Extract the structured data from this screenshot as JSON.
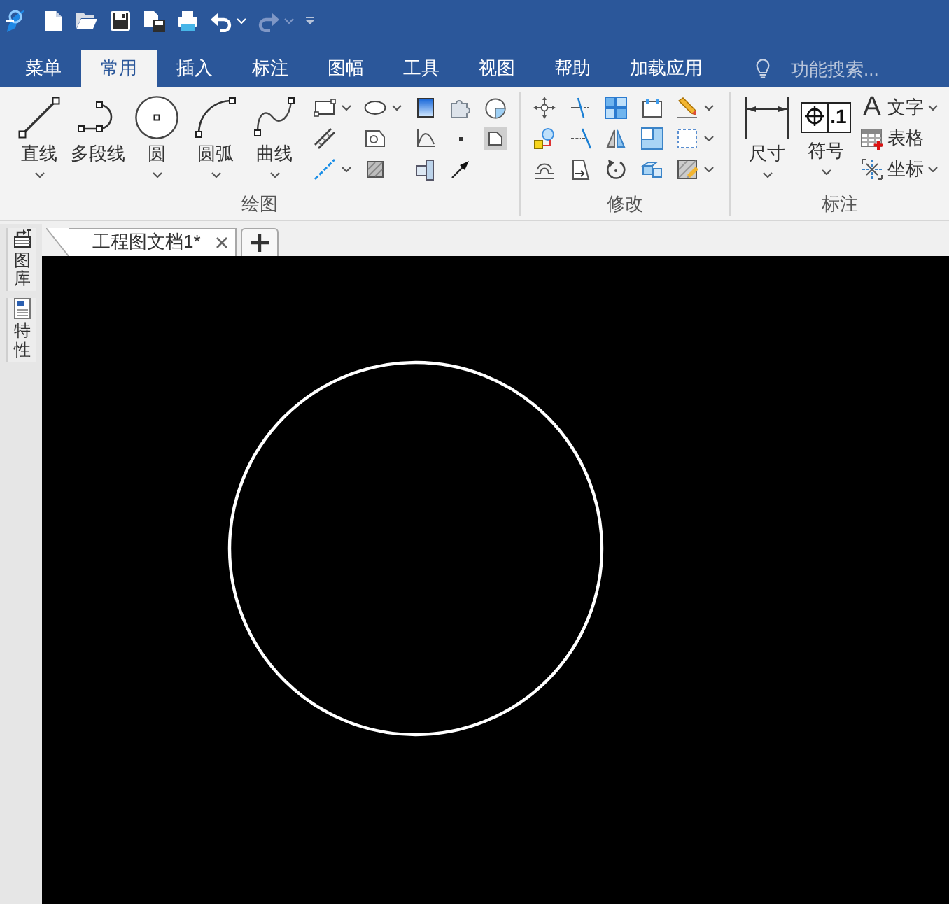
{
  "quick_access": [
    {
      "disabled": false
    },
    {
      "disabled": false
    },
    {
      "disabled": false
    },
    {
      "disabled": false
    },
    {
      "disabled": false
    },
    {
      "disabled": false
    },
    {
      "disabled": true
    }
  ],
  "menu_tabs": [
    {
      "label": "菜单",
      "selected": false
    },
    {
      "label": "常用",
      "selected": true
    },
    {
      "label": "插入",
      "selected": false
    },
    {
      "label": "标注",
      "selected": false
    },
    {
      "label": "图幅",
      "selected": false
    },
    {
      "label": "工具",
      "selected": false
    },
    {
      "label": "视图",
      "selected": false
    },
    {
      "label": "帮助",
      "selected": false
    },
    {
      "label": "加载应用",
      "selected": false
    }
  ],
  "search": {
    "placeholder": "功能搜索..."
  },
  "ribbon": {
    "groups": [
      {
        "label": "绘图",
        "large_tools": [
          {
            "label": "直线",
            "dropdown": true
          },
          {
            "label": "多段线",
            "dropdown": false
          },
          {
            "label": "圆",
            "dropdown": true
          },
          {
            "label": "圆弧",
            "dropdown": true
          },
          {
            "label": "曲线",
            "dropdown": true
          }
        ],
        "small_tools": [
          {
            "dropdown": true
          },
          {
            "dropdown": true
          },
          {
            "dropdown": false
          },
          {
            "dropdown": false
          },
          {
            "dropdown": false
          },
          {
            "dropdown": false
          },
          {
            "dropdown": false
          },
          {
            "dropdown": false
          },
          {
            "dropdown": false
          },
          {
            "dropdown": false
          },
          {
            "dropdown": true
          },
          {
            "dropdown": false
          },
          {
            "dropdown": false
          },
          {
            "dropdown": false
          }
        ]
      },
      {
        "label": "修改",
        "small_tools": [
          {
            "dropdown": false
          },
          {
            "dropdown": false
          },
          {
            "dropdown": false
          },
          {
            "dropdown": false
          },
          {
            "dropdown": true
          },
          {
            "dropdown": false
          },
          {
            "dropdown": false
          },
          {
            "dropdown": false
          },
          {
            "dropdown": false
          },
          {
            "dropdown": true
          },
          {
            "dropdown": false
          },
          {
            "dropdown": false
          },
          {
            "dropdown": false
          },
          {
            "dropdown": false
          },
          {
            "dropdown": true
          }
        ]
      },
      {
        "label": "标注",
        "large_tools": [
          {
            "label": "尺寸",
            "dropdown": true
          },
          {
            "label": "符号",
            "icon_text": ".1",
            "dropdown": true
          }
        ],
        "labeled_tools": [
          {
            "label": "文字",
            "icon_text": "A",
            "dropdown": true
          },
          {
            "label": "表格",
            "dropdown": false
          },
          {
            "label": "坐标",
            "dropdown": true
          }
        ]
      }
    ]
  },
  "document_tabs": [
    {
      "label": "工程图文档1*",
      "selected": true
    }
  ],
  "side_panels": [
    {
      "label": "图库"
    },
    {
      "label": "特性"
    }
  ]
}
